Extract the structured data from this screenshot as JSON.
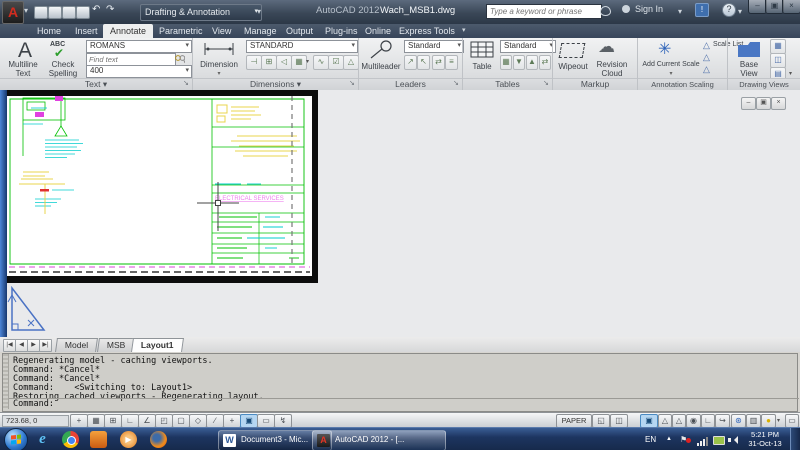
{
  "titlebar": {
    "app_title": "AutoCAD 2012",
    "doc_title": "Wach_MSB1.dwg",
    "workspace": "Drafting & Annotation",
    "search_placeholder": "Type a keyword or phrase",
    "signin_label": "Sign In"
  },
  "ribbon_tabs": [
    {
      "label": "Home"
    },
    {
      "label": "Insert"
    },
    {
      "label": "Annotate"
    },
    {
      "label": "Parametric"
    },
    {
      "label": "View"
    },
    {
      "label": "Manage"
    },
    {
      "label": "Output"
    },
    {
      "label": "Plug-ins"
    },
    {
      "label": "Online"
    },
    {
      "label": "Express Tools"
    }
  ],
  "ribbon": {
    "text_panel": {
      "title": "Text ▾",
      "multiline_line1": "Multiline",
      "multiline_line2": "Text",
      "spelling_line1": "Check",
      "spelling_line2": "Spelling",
      "style_value": "ROMANS",
      "find_placeholder": "Find text",
      "height_value": "400"
    },
    "dimensions_panel": {
      "title": "Dimensions ▾",
      "dimension_label": "Dimension",
      "style_value": "STANDARD"
    },
    "leaders_panel": {
      "title": "Leaders",
      "multileader_label": "Multileader",
      "style_value": "Standard"
    },
    "tables_panel": {
      "title": "Tables",
      "table_label": "Table",
      "style_value": "Standard"
    },
    "markup_panel": {
      "title": "Markup",
      "wipeout_label": "Wipeout",
      "revcloud_line1": "Revision",
      "revcloud_line2": "Cloud"
    },
    "annotation_scaling_panel": {
      "title": "Annotation Scaling",
      "add_scale_label": "Add Current Scale",
      "scale_list_label": "Scale List"
    },
    "drawing_views_panel": {
      "title": "Drawing Views",
      "base_line1": "Base",
      "base_line2": "View"
    }
  },
  "drawing": {
    "title_block_text": "ELECTRICAL SERVICES"
  },
  "layout_tabs": [
    {
      "label": "Model"
    },
    {
      "label": "MSB"
    },
    {
      "label": "Layout1"
    }
  ],
  "command_window": {
    "history": [
      "Regenerating model - caching viewports.",
      "Command: *Cancel*",
      "Command: *Cancel*",
      "Command:    <Switching to: Layout1>",
      "Restoring cached viewports - Regenerating layout."
    ],
    "prompt": "Command:"
  },
  "statusbar": {
    "coords": "723.68, 0",
    "paper_label": "PAPER",
    "toggles": [
      {
        "glyph": "+"
      },
      {
        "glyph": "▦"
      },
      {
        "glyph": "⊞"
      },
      {
        "glyph": "∟"
      },
      {
        "glyph": "∠"
      },
      {
        "glyph": "◰"
      },
      {
        "glyph": "▢"
      },
      {
        "glyph": "◇"
      },
      {
        "glyph": "∕"
      },
      {
        "glyph": "+"
      },
      {
        "glyph": "▣"
      },
      {
        "glyph": "▭"
      },
      {
        "glyph": "↯"
      }
    ],
    "right_icons": [
      {
        "glyph": "◱"
      },
      {
        "glyph": "◫"
      },
      {
        "glyph": "▣"
      },
      {
        "glyph": "△"
      },
      {
        "glyph": "△"
      },
      {
        "glyph": "◉"
      },
      {
        "glyph": "∟"
      },
      {
        "glyph": "↪"
      },
      {
        "glyph": "⊛"
      },
      {
        "glyph": "▥"
      },
      {
        "glyph": "●"
      },
      {
        "glyph": "▾"
      },
      {
        "glyph": "▭"
      }
    ]
  },
  "taskbar": {
    "task_word": "Document3 - Mic...",
    "task_autocad": "AutoCAD 2012 - [...",
    "tray_lang": "EN",
    "time": "5:21 PM",
    "date": "31-Oct-13"
  },
  "icons": {
    "logo": "A",
    "dropdown": "▾",
    "undo": "↶",
    "redo": "↷",
    "help": "?",
    "win_min": "–",
    "win_restore": "▣",
    "win_close": "×",
    "mtext": "A",
    "abc": "ABC",
    "check": "✔",
    "revcloud": "☁",
    "add_scale": "✳",
    "scale_tri": "△",
    "dim_small": [
      "⊣",
      "⊞",
      "◁",
      "▦",
      "∿",
      "☑",
      "△"
    ],
    "leader_small": [
      "↗",
      "↖",
      "⇄",
      "≡"
    ],
    "table_small": [
      "▦",
      "▼",
      "▲",
      "⇄"
    ],
    "dv_small": [
      "▦",
      "◫",
      "▤"
    ],
    "nav_first": "|◀",
    "nav_prev": "◀",
    "nav_next": "▶",
    "nav_last": "▶|"
  }
}
